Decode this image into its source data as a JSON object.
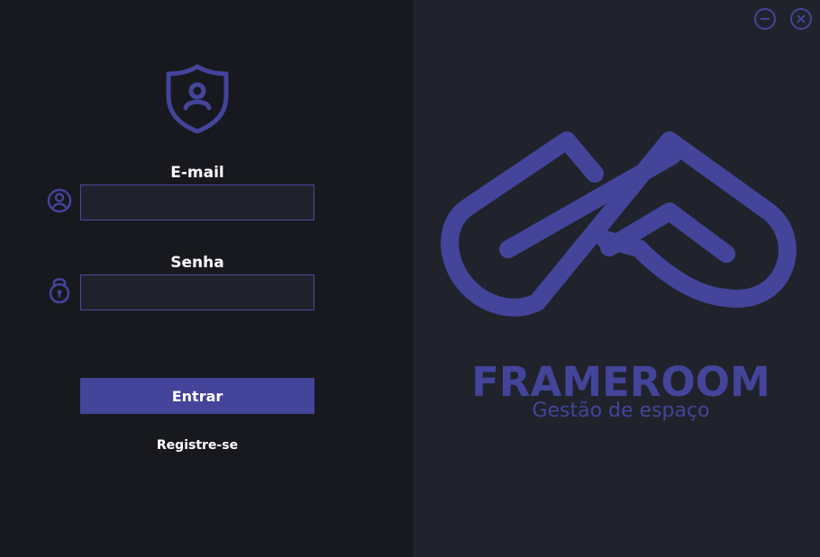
{
  "login": {
    "email_label": "E-mail",
    "email_value": "",
    "email_placeholder": "",
    "password_label": "Senha",
    "password_value": "",
    "password_placeholder": "",
    "submit_label": "Entrar",
    "register_label": "Registre-se"
  },
  "brand": {
    "name": "FRAMEROOM",
    "tagline": "Gestão de espaço"
  },
  "icons": {
    "shield": "shield-user-icon",
    "user": "user-circle-icon",
    "lock": "lock-icon",
    "minimize": "minimize-icon",
    "close": "close-icon",
    "logo": "frameroom-logo-icon"
  },
  "colors": {
    "accent": "#43449a",
    "left_background": "#17191e",
    "right_background": "#20232b",
    "input_background": "#20232b",
    "input_border": "#4a4aa0",
    "text": "#ffffff"
  }
}
